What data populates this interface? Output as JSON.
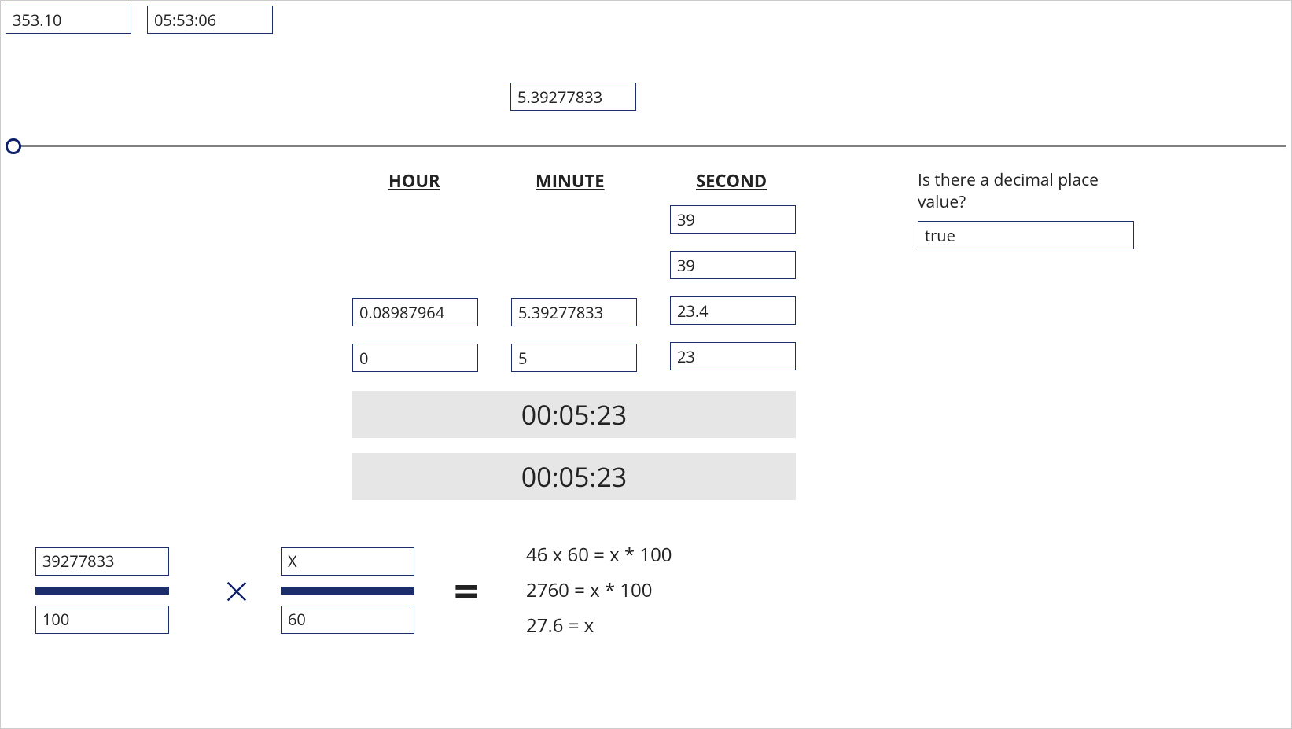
{
  "top": {
    "a": "353.10",
    "b": "05:53:06"
  },
  "midValue": "5.39277833",
  "headers": {
    "hour": "HOUR",
    "minute": "MINUTE",
    "second": "SECOND"
  },
  "columns": {
    "second": {
      "r1": "39",
      "r2": "39",
      "r3": "23.4",
      "r4": "23"
    },
    "minute": {
      "r3": "5.39277833",
      "r4": "5"
    },
    "hour": {
      "r3": "0.08987964",
      "r4": "0"
    }
  },
  "bars": {
    "b1": "00:05:23",
    "b2": "00:05:23"
  },
  "question": {
    "label": "Is there a decimal place value?",
    "value": "true"
  },
  "fractions": {
    "left": {
      "num": "39277833",
      "den": "100"
    },
    "right": {
      "num": "X",
      "den": "60"
    }
  },
  "equations": {
    "l1": "46 x 60 = x * 100",
    "l2": "2760 = x * 100",
    "l3": "27.6 = x"
  }
}
